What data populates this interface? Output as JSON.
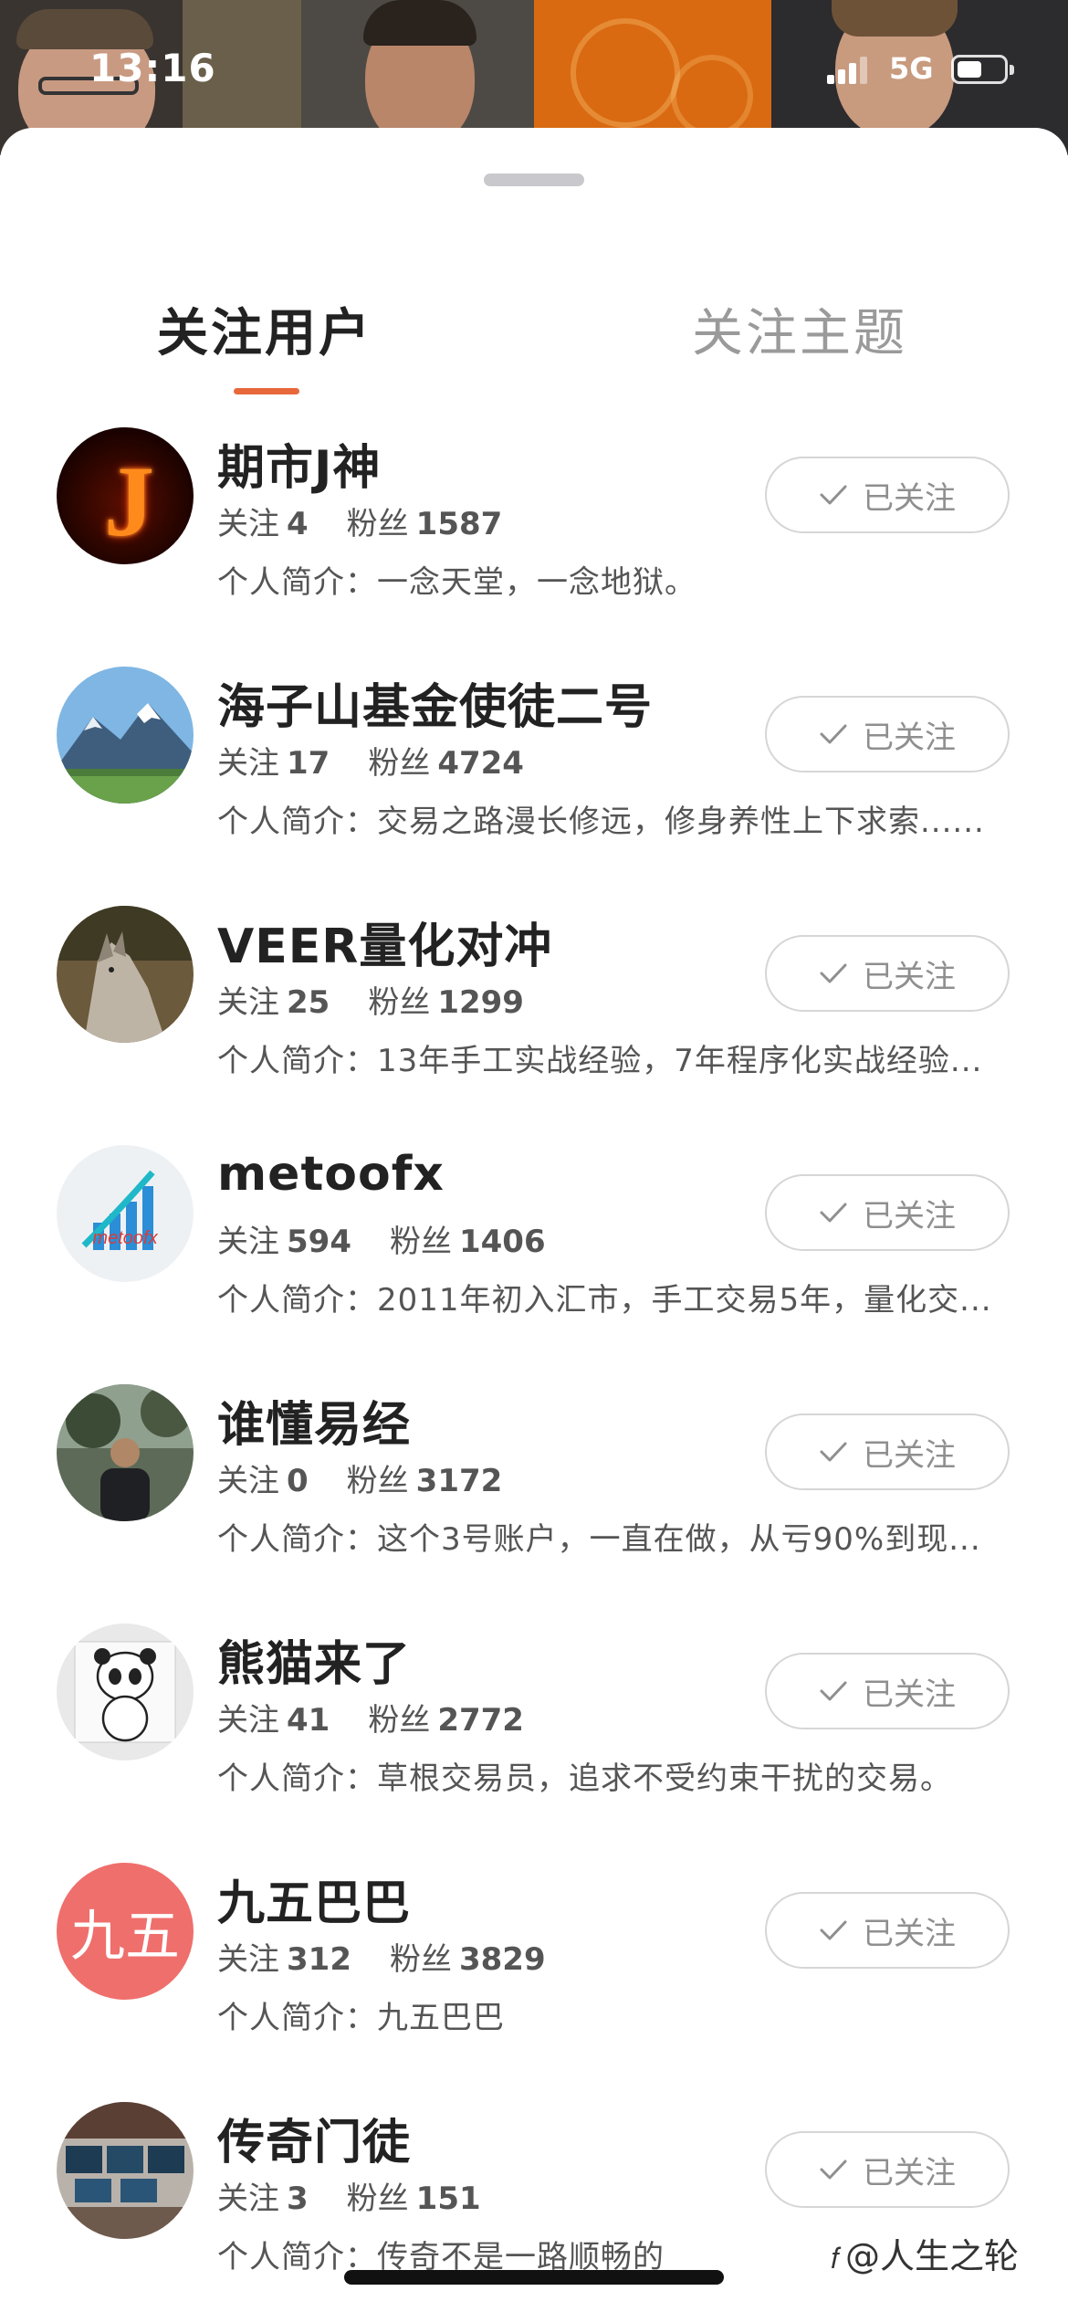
{
  "status_bar": {
    "time": "13:16",
    "network": "5G"
  },
  "tabs": [
    {
      "label": "关注用户",
      "active": true
    },
    {
      "label": "关注主题",
      "active": false
    }
  ],
  "follow_label": "已关注",
  "stat_labels": {
    "following": "关注",
    "followers": "粉丝"
  },
  "users": [
    {
      "name": "期市J神",
      "following": "4",
      "followers": "1587",
      "bio": "个人简介：一念天堂，一念地狱。",
      "avatar": "flaming-j-logo"
    },
    {
      "name": "海子山基金使徒二号",
      "following": "17",
      "followers": "4724",
      "bio": "个人简介：交易之路漫长修远，修身养性上下求索......",
      "avatar": "mountain-landscape"
    },
    {
      "name": "VEER量化对冲",
      "following": "25",
      "followers": "1299",
      "bio": "个人简介：13年手工实战经验，7年程序化实战经验...",
      "avatar": "wolf-photo"
    },
    {
      "name": "metoofx",
      "following": "594",
      "followers": "1406",
      "bio": "个人简介：2011年初入汇市，手工交易5年，量化交...",
      "avatar": "metoofx-logo"
    },
    {
      "name": "谁懂易经",
      "following": "0",
      "followers": "3172",
      "bio": "个人简介：这个3号账户，一直在做，从亏90%到现...",
      "avatar": "person-outdoors"
    },
    {
      "name": "熊猫来了",
      "following": "41",
      "followers": "2772",
      "bio": "个人简介：草根交易员，追求不受约束干扰的交易。",
      "avatar": "panda-cartoon"
    },
    {
      "name": "九五巴巴",
      "following": "312",
      "followers": "3829",
      "bio": "个人简介：九五巴巴",
      "avatar_text": "九五",
      "avatar_color": "#ef6f6c",
      "avatar": "text-avatar"
    },
    {
      "name": "传奇门徒",
      "following": "3",
      "followers": "151",
      "bio": "个人简介：传奇不是一路顺畅的",
      "avatar": "trading-desk-photo"
    }
  ],
  "watermark": {
    "icon": "𝑓",
    "text": "@人生之轮"
  },
  "colors": {
    "accent": "#e8683b"
  }
}
